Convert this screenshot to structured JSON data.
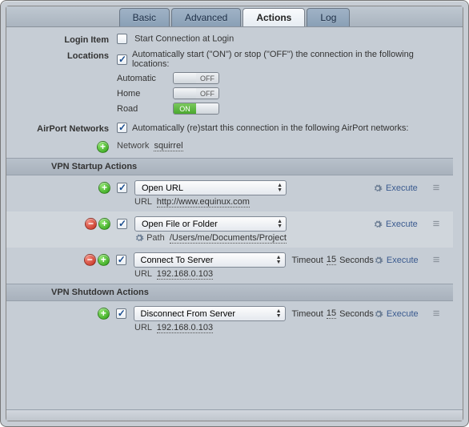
{
  "tabs": {
    "basic": "Basic",
    "advanced": "Advanced",
    "actions": "Actions",
    "log": "Log"
  },
  "login": {
    "label": "Login Item",
    "text": "Start Connection at Login"
  },
  "locations": {
    "label": "Locations",
    "text": "Automatically start (\"ON\") or stop (\"OFF\") the connection in the following locations:",
    "items": [
      {
        "name": "Automatic",
        "state": "OFF"
      },
      {
        "name": "Home",
        "state": "OFF"
      },
      {
        "name": "Road",
        "state": "ON"
      }
    ]
  },
  "airport": {
    "label": "AirPort Networks",
    "text": "Automatically (re)start this connection in the following AirPort networks:",
    "network_key": "Network",
    "network_val": "squirrel"
  },
  "startup": {
    "header": "VPN Startup Actions",
    "actions": [
      {
        "type": "Open URL",
        "key": "URL",
        "val": "http://www.equinux.com",
        "timeout": null
      },
      {
        "type": "Open File or Folder",
        "key": "Path",
        "val": "/Users/me/Documents/Project",
        "timeout": null
      },
      {
        "type": "Connect To Server",
        "key": "URL",
        "val": "192.168.0.103",
        "timeout": "15",
        "timeout_unit": "Seconds",
        "timeout_label": "Timeout"
      }
    ]
  },
  "shutdown": {
    "header": "VPN Shutdown Actions",
    "actions": [
      {
        "type": "Disconnect From Server",
        "key": "URL",
        "val": "192.168.0.103",
        "timeout": "15",
        "timeout_unit": "Seconds",
        "timeout_label": "Timeout"
      }
    ]
  },
  "execute_label": "Execute"
}
